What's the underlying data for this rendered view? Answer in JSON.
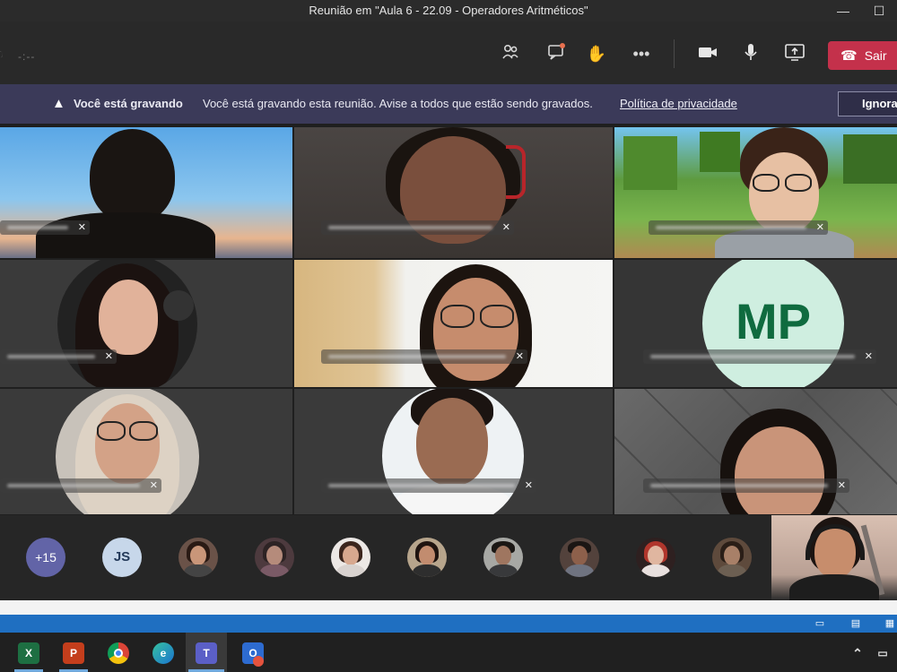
{
  "window": {
    "title": "Reunião em \"Aula 6 - 22.09 - Operadores Aritméticos\"",
    "minimize_icon": "minimize-icon",
    "maximize_icon": "maximize-icon"
  },
  "toolbar": {
    "timer": "-:--",
    "icons": [
      "participants-icon",
      "chat-icon",
      "raise-hand-icon",
      "more-options-icon",
      "camera-icon",
      "microphone-icon",
      "share-screen-icon"
    ],
    "leave_label": "Sair",
    "leave_color": "#c4314b"
  },
  "banner": {
    "title": "Você está gravando",
    "message": "Você está gravando esta reunião. Avise a todos que estão sendo gravados.",
    "privacy_link": "Política de privacidade",
    "ignore_label": "Ignorar",
    "background": "#3b3a59"
  },
  "grid": {
    "initials_tile": "MP",
    "initials_color": "#cfeee0"
  },
  "strip": {
    "overflow_count": "+15",
    "initials_avatar": "JS"
  },
  "taskbar": {
    "apps": [
      "excel-icon",
      "powerpoint-icon",
      "chrome-icon",
      "edge-icon",
      "teams-icon",
      "outlook-icon"
    ]
  }
}
